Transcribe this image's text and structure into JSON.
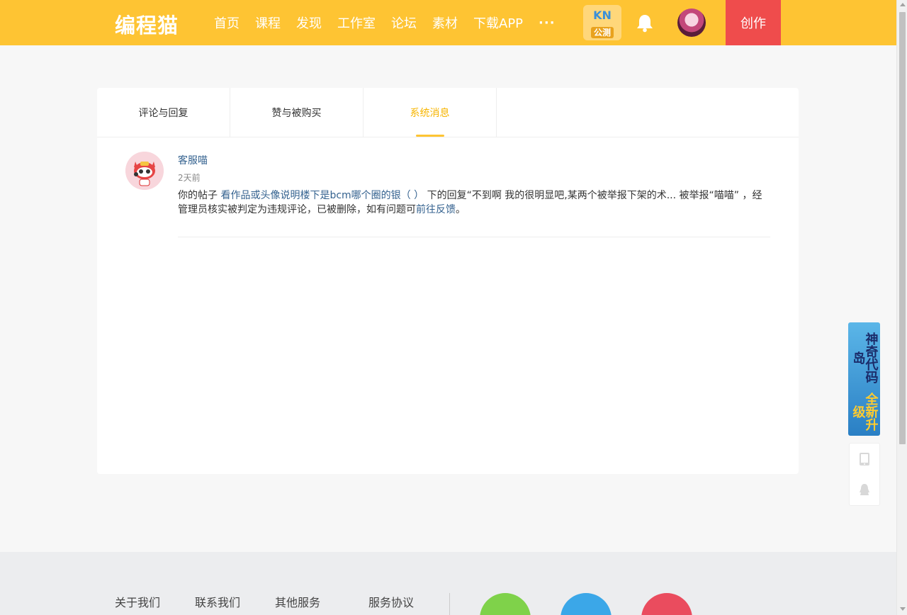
{
  "header": {
    "logo": "编程猫",
    "nav": [
      "首页",
      "课程",
      "发现",
      "工作室",
      "论坛",
      "素材",
      "下载APP"
    ],
    "more": "···",
    "kn_badge": {
      "title": "KN",
      "subtitle": "公测"
    },
    "create_label": "创作",
    "colors": {
      "bar": "#fec433",
      "create": "#ef4c4c"
    }
  },
  "tabs": [
    {
      "label": "评论与回复",
      "active": false
    },
    {
      "label": "赞与被购买",
      "active": false
    },
    {
      "label": "系统消息",
      "active": true
    }
  ],
  "message": {
    "user": "客服喵",
    "time": "2天前",
    "text_prefix": "你的帖子 ",
    "post_link": "看作品或头像说明楼下是bcm哪个圈的银（ ）",
    "text_middle": " 下的回复“不到啊 我的很明显吧,某两个被举报下架的术... 被举报“喵喵” ，经管理员核实被判定为违规评论，已被删除，如有问题可",
    "feedback_link": "前往反馈",
    "text_suffix": "。"
  },
  "promo": {
    "text_a": "神奇代码岛",
    "text_b": "全新升级"
  },
  "footer": {
    "links": [
      "关于我们",
      "联系我们",
      "其他服务",
      "服务协议"
    ]
  }
}
